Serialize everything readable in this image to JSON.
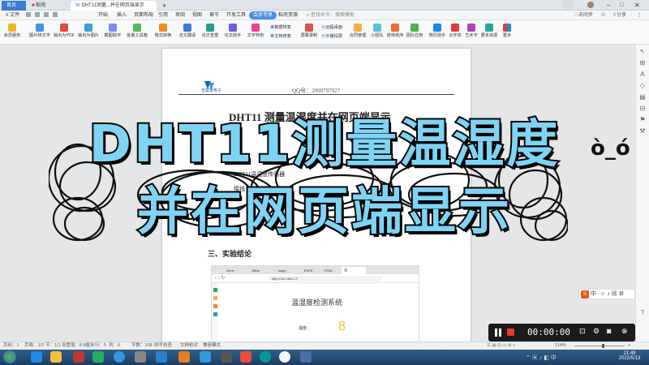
{
  "titlebar": {
    "tabs": [
      {
        "label": "首页"
      },
      {
        "label": "稻壳"
      },
      {
        "label": "DHT11测量...并在网页端显示"
      }
    ],
    "new_tab": "+",
    "user_label": "未同步",
    "share_label": "分享"
  },
  "menubar": {
    "file": "文件",
    "items": [
      "开始",
      "插入",
      "页面布局",
      "引用",
      "审阅",
      "视图",
      "章节",
      "开发工具",
      "会员专享",
      "稻壳资源"
    ],
    "active": "会员专享",
    "search_placeholder": "查找命令、搜索模板"
  },
  "ribbon": {
    "items": [
      "会员服务",
      "图片转文字",
      "输出为PDF",
      "输出为图片",
      "截图取字",
      "批量工具箱",
      "格式转换",
      "全文翻译",
      "论文查重",
      "论文助手",
      "文字特色",
      "数据恢复",
      "文档修复",
      "屏幕录制",
      "远程桌面",
      "乐播投屏",
      "合同管理",
      "小团队",
      "道林纸序",
      "团队应用",
      "简历助手",
      "云字体",
      "艺术字",
      "更多资源",
      "更多"
    ]
  },
  "document": {
    "logo_text": "苦莫雷电子",
    "qq": "QQ号：2090797927",
    "title": "DHT11 测量温湿度并在网页端显示",
    "section3": "三、实验结论",
    "line1": "DHT11温湿度传感器",
    "line2": "接线"
  },
  "browser": {
    "tabs": [
      "Gene",
      "Bildu",
      "wapp",
      "ESP8",
      "HTML",
      "温"
    ],
    "url": "http://192.168.1.7/",
    "heading": "温湿度检测系统",
    "temp_label": "温度：",
    "temp_value": "8"
  },
  "overlay": {
    "line1": "DHT11测量温湿度",
    "line2": "并在网页端显示",
    "emoji": "ò_ó"
  },
  "recorder": {
    "time": "00:00:00"
  },
  "statusbar": {
    "page": "页码：1",
    "pages": "页面：1/2",
    "section": "节：1/1",
    "setting": "设置值：8.8厘米",
    "row": "行：5",
    "col": "列：6",
    "words": "字数：108",
    "spell": "拼写检查",
    "proof": "文档校对",
    "compat": "兼容模式",
    "zoom": "114%"
  },
  "taskbar": {
    "time": "21:49",
    "date": "2022/5/13"
  },
  "colors": {
    "overlay_fill": "#7fd3f5",
    "active_menu": "#4a90e2",
    "taskbar": "#1d3f62"
  }
}
